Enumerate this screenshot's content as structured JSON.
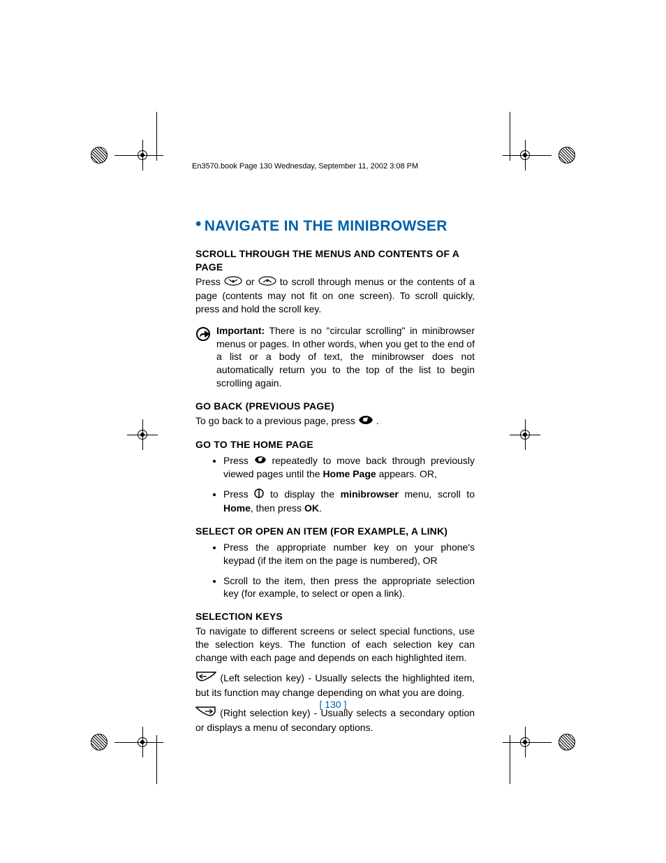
{
  "header": "En3570.book  Page 130  Wednesday, September 11, 2002  3:08 PM",
  "title": "NAVIGATE IN THE MINIBROWSER",
  "sections": {
    "s1": {
      "heading": "SCROLL THROUGH THE MENUS AND CONTENTS OF A PAGE",
      "p1a": "Press ",
      "p1b": " or ",
      "p1c": " to scroll through menus or the contents of a page (contents may not fit on one screen). To scroll quickly, press and hold the scroll key."
    },
    "important": {
      "label": "Important:",
      "text": " There is no \"circular scrolling\" in minibrowser menus or pages. In other words, when you get to the end of a list or a body of text, the minibrowser does not automatically return you to the top of the list to begin scrolling again."
    },
    "s2": {
      "heading": "GO BACK (PREVIOUS PAGE)",
      "p1a": "To go back to a previous page, press ",
      "p1b": "."
    },
    "s3": {
      "heading": "GO TO THE HOME PAGE",
      "li1a": "Press ",
      "li1b": " repeatedly to move back through previously viewed pages until the ",
      "li1_bold": "Home Page",
      "li1c": " appears. OR,",
      "li2a": "Press ",
      "li2b": " to display the ",
      "li2_bold1": "minibrowser",
      "li2c": " menu, scroll to ",
      "li2_bold2": "Home",
      "li2d": ", then press ",
      "li2_bold3": "OK",
      "li2e": "."
    },
    "s4": {
      "heading": "SELECT OR OPEN AN ITEM (FOR EXAMPLE, A LINK)",
      "li1": "Press the appropriate number key on your phone's keypad (if the item on the page is numbered), OR",
      "li2": "Scroll to the item, then press the appropriate selection key (for example, to select or open a link)."
    },
    "s5": {
      "heading": "SELECTION KEYS",
      "p1": "To navigate to different screens or select special functions, use the selection keys. The function of each selection key can change with each page and depends on each highlighted item.",
      "left": " (Left selection key) - Usually selects the highlighted item, but its function may change depending on what you are doing.",
      "right": " (Right selection key) - Usually selects a secondary option or displays a menu of secondary options."
    }
  },
  "page_number": "[ 130 ]"
}
